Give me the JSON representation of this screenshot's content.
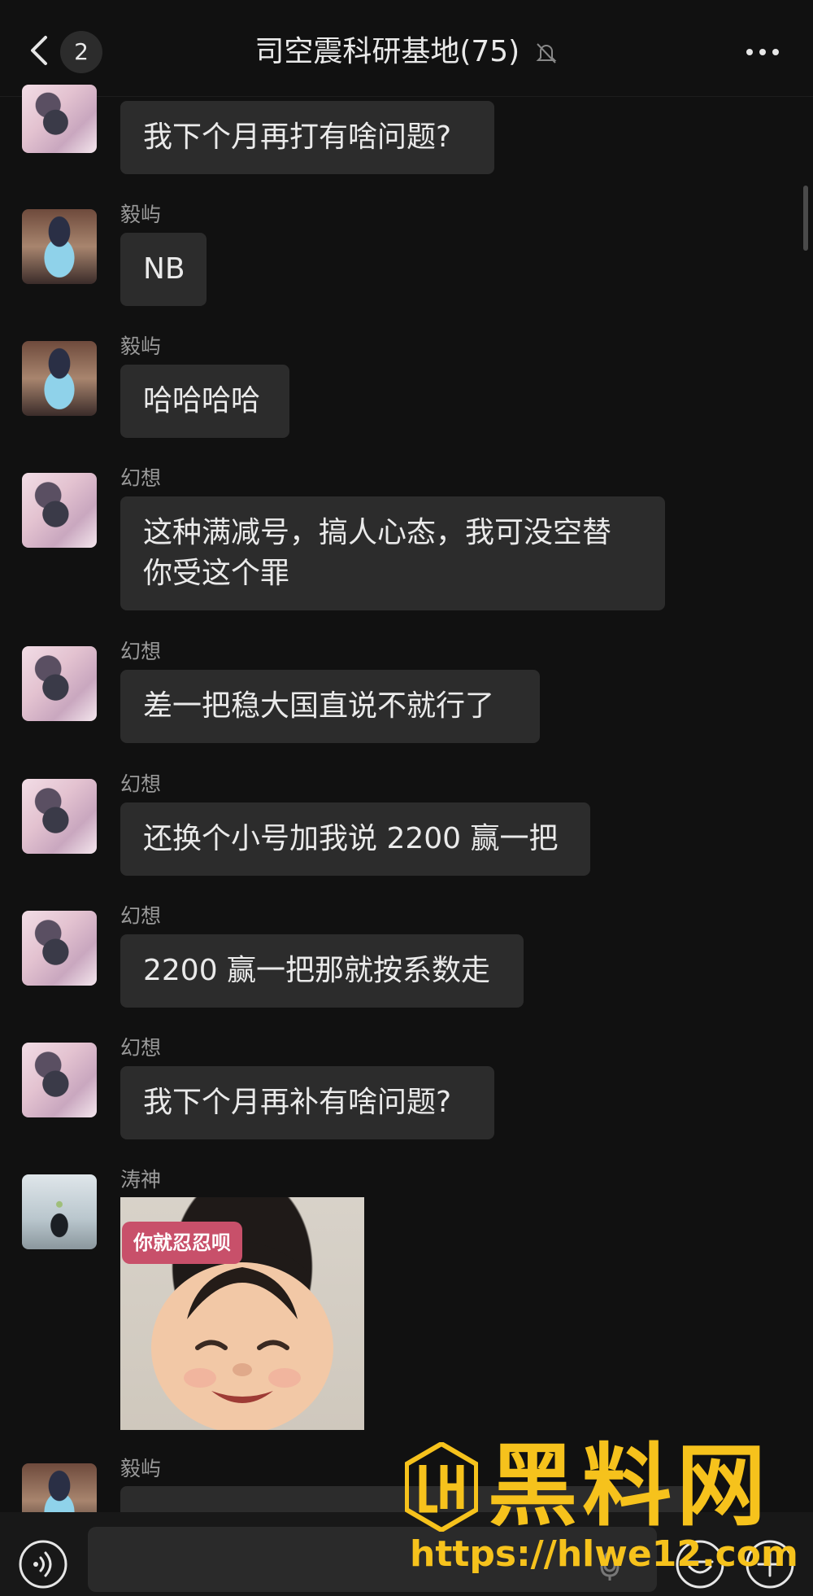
{
  "header": {
    "unread_count": "2",
    "title": "司空震科研基地(75)"
  },
  "messages": [
    {
      "sender": "",
      "text": "我下个月再打有啥问题?"
    },
    {
      "sender": "毅屿",
      "text": "NB"
    },
    {
      "sender": "毅屿",
      "text": "哈哈哈哈"
    },
    {
      "sender": "幻想",
      "text": "这种满减号，搞人心态，我可没空替\n你受这个罪"
    },
    {
      "sender": "幻想",
      "text": "差一把稳大国直说不就行了"
    },
    {
      "sender": "幻想",
      "text": "还换个小号加我说 2200 赢一把"
    },
    {
      "sender": "幻想",
      "text": "2200 赢一把那就按系数走"
    },
    {
      "sender": "幻想",
      "text": "我下个月再补有啥问题?"
    },
    {
      "sender": "涛神",
      "sticker_text": "你就忍忍呗"
    },
    {
      "sender": "毅屿",
      "text": ""
    }
  ],
  "watermark": {
    "title": "黑料网",
    "url": "https://hlwe12.com"
  },
  "icons": {
    "back": "chevron-left-icon",
    "mute": "bell-off-icon",
    "more": "more-dots-icon",
    "voice": "voice-icon",
    "mic": "microphone-icon",
    "emoji": "emoji-icon",
    "plus": "plus-icon"
  },
  "colors": {
    "background": "#111111",
    "bubble": "#2c2c2c",
    "text": "#eaeaea",
    "name": "#9a9a9a",
    "watermark": "#f6c21c"
  }
}
